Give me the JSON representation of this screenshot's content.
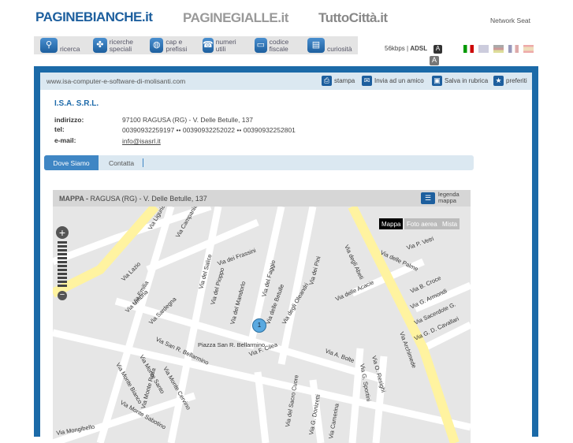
{
  "header": {
    "logos": [
      "PAGINEBIANCHE.it",
      "PAGINEGIALLE.it",
      "TuttoCittà.it"
    ],
    "network": "Network Seat"
  },
  "nav": [
    {
      "label": "ricerca",
      "icon": "search-icon"
    },
    {
      "label": "ricerche speciali",
      "icon": "clover-icon"
    },
    {
      "label": "cap e prefissi",
      "icon": "globe-icon"
    },
    {
      "label": "numeri utili",
      "icon": "phone-icon"
    },
    {
      "label": "codice fiscale",
      "icon": "card-icon"
    },
    {
      "label": "curiosità",
      "icon": "book-icon"
    }
  ],
  "speed": {
    "low": "56kbps",
    "high": "ADSL",
    "font_a": "A"
  },
  "languages": [
    "it",
    "en",
    "de",
    "fr",
    "es"
  ],
  "url": "www.isa-computer-e-software-di-molisanti.com",
  "actions": {
    "print": "stampa",
    "send": "Invia ad un amico",
    "save": "Salva in rubrica",
    "fav": "preferiti"
  },
  "company": {
    "name": "I.S.A. S.R.L.",
    "address_label": "indirizzo:",
    "address": "97100 RAGUSA (RG) - V. Delle Betulle, 137",
    "tel_label": "tel:",
    "tel": "00390932259197 •• 00390932252022 •• 00390932252801",
    "email_label": "e-mail:",
    "email": "info@isasrl.it"
  },
  "tabs": {
    "where": "Dove Siamo",
    "contact": "Contatta"
  },
  "map": {
    "title": "MAPPA -",
    "subtitle": "RAGUSA (RG) - V. Delle Betulle, 137",
    "legend": "legenda mappa",
    "types": [
      "Mappa",
      "Foto aerea",
      "Mista"
    ],
    "marker": "1",
    "streets": [
      "Via Lazio",
      "Via Emilia",
      "Via Umbria",
      "Via Sardegna",
      "Via del Salice",
      "Via del Pioppo",
      "Via dei Frassini",
      "Via del Mandorlo",
      "Via del Faggio",
      "Via delle Betulle",
      "Via degli Oleandri",
      "Via dei Pini",
      "Via degli Abeti",
      "Via delle Acacie",
      "Via Archimede",
      "Via delle Palme",
      "Via P. Vetri",
      "Via B. Croce",
      "Via G. Armondi",
      "Via Sacerdote G.",
      "Via G. D. Cavallari",
      "Via A. Bolte",
      "Via O. Resighi",
      "Via G. Sportini",
      "Via F. Cilea",
      "Piazza San R. Bellarmino",
      "Via San R. Bellarmino",
      "Via Monte Bianco",
      "Via Monte Santo",
      "Via Monte Cervino",
      "Via Monte Rosa",
      "Via Mongibello",
      "Via Monte Sabotino",
      "Via del Sacro Cuore",
      "Via G. Donizetti",
      "Via Camerina",
      "Via Campania",
      "Via Liguria"
    ]
  }
}
